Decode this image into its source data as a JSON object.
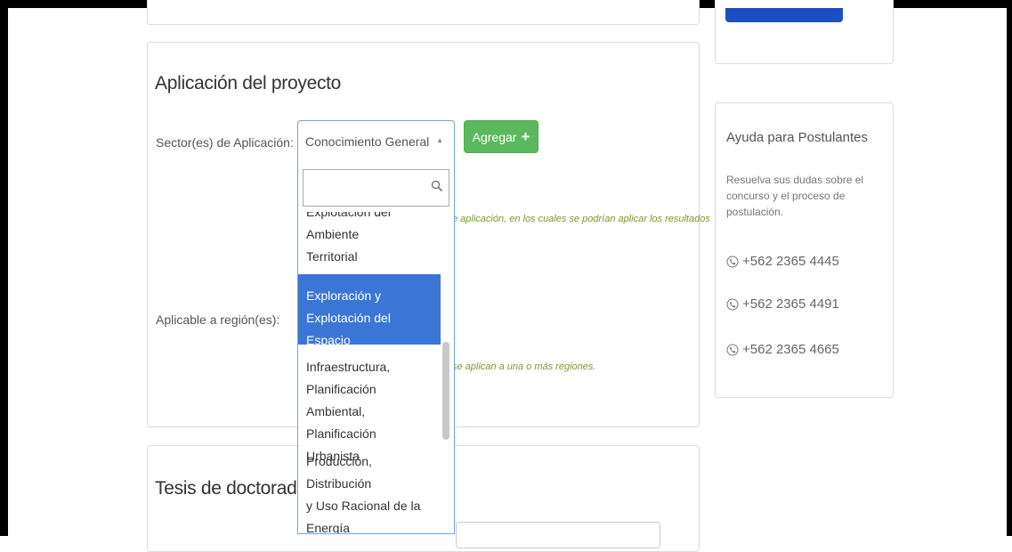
{
  "application_section": {
    "heading": "Aplicación del proyecto",
    "sector_label": "Sector(es) de Aplicación:",
    "sector_selected": "Conocimiento General",
    "add_button_label": "Agregar",
    "sector_hint": "e aplicación, en los cuales se podrían aplicar los resultados",
    "region_label": "Aplicable a región(es):",
    "region_hint": "se aplican a una o más regiones."
  },
  "dropdown": {
    "search_value": "",
    "items": [
      {
        "line1": "Explotación del Ambiente",
        "line2": "Territorial"
      },
      {
        "line1": "Exploración y",
        "line2": "Explotación del Espacio"
      },
      {
        "line1": "Infraestructura,",
        "line2": "Planificación Ambiental,",
        "line3": "Planificación Urbanista"
      },
      {
        "line1": "Producción, Distribución",
        "line2": "y Uso Racional de la",
        "line3": "Energía"
      }
    ]
  },
  "tesis_section": {
    "heading": "Tesis de doctorado"
  },
  "help": {
    "title": "Ayuda para Postulantes",
    "description": "Resuelva sus dudas sobre el concurso y el proceso de postulación.",
    "phones": [
      "+562 2365 4445",
      "+562 2365 4491",
      "+562 2365 4665"
    ]
  },
  "colors": {
    "accent_blue": "#3b76d6",
    "success_green": "#5cb85c",
    "hint_olive": "#7a9a2a"
  }
}
